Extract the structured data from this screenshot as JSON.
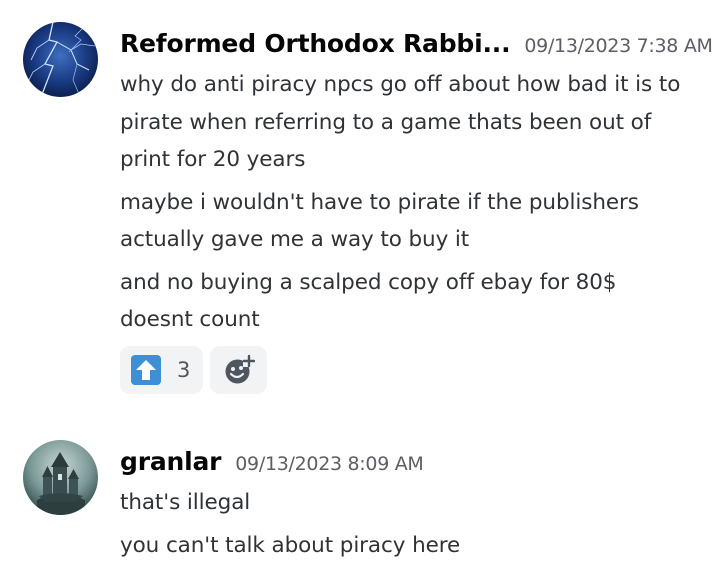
{
  "messages": [
    {
      "author": "Reformed Orthodox Rabbi...",
      "timestamp": "09/13/2023 7:38 AM",
      "lines": [
        "why do anti piracy npcs go off about how bad it is to",
        "pirate when referring to a game thats been out of",
        "print for 20 years",
        "maybe i wouldn't have to pirate if the publishers",
        "actually gave me a way to buy it",
        "and no buying a scalped copy off ebay for 80$",
        "doesnt count"
      ],
      "reactions": [
        {
          "emoji": "up-arrow-icon",
          "count": "3"
        }
      ]
    },
    {
      "author": "granlar",
      "timestamp": "09/13/2023 8:09 AM",
      "lines": [
        "that's illegal",
        "you can't talk about piracy here"
      ]
    }
  ],
  "colors": {
    "username": "#060607",
    "timestamp": "#5c5e66",
    "text": "#2e3338",
    "reaction_bg": "#f2f3f5",
    "upvote_emoji": "#3d8fd6"
  }
}
